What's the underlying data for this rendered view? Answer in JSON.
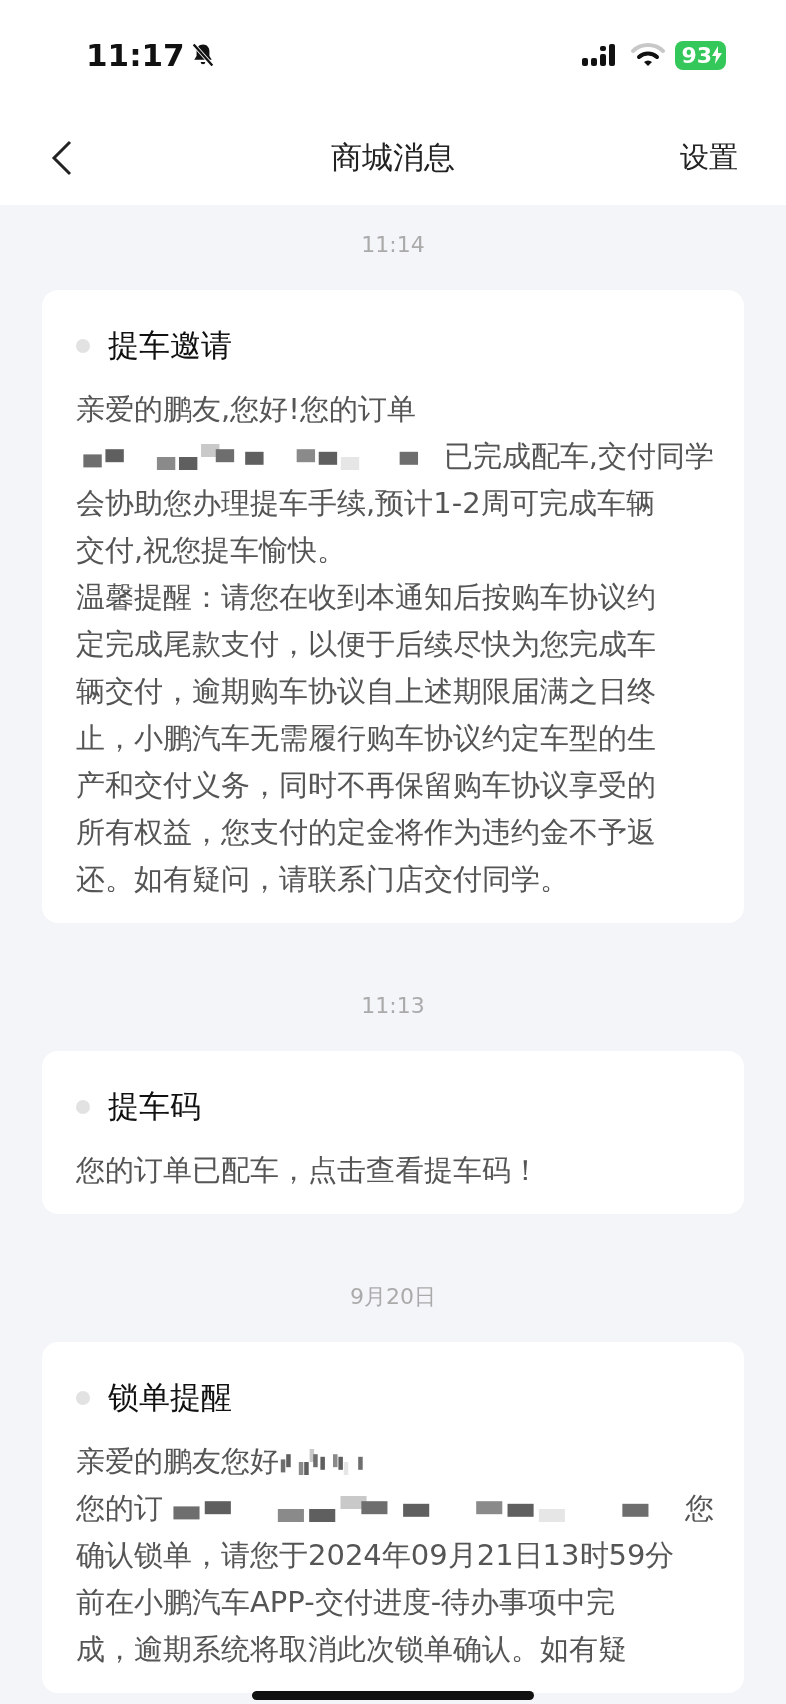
{
  "status_bar": {
    "time": "11:17",
    "battery": "93"
  },
  "nav": {
    "title": "商城消息",
    "action": "设置"
  },
  "groups": [
    {
      "time": "11:14",
      "message": {
        "title": "提车邀请",
        "lines": [
          [
            {
              "kind": "text",
              "text": "亲爱的鹏友,您好!您的订单"
            }
          ],
          [
            {
              "kind": "redacted"
            },
            {
              "kind": "text",
              "text": "已完成配车,交付同学"
            }
          ],
          [
            {
              "kind": "text",
              "text": "会协助您办理提车手续,预计1-2周可完成车辆"
            }
          ],
          [
            {
              "kind": "text",
              "text": "交付,祝您提车愉快。"
            }
          ],
          [
            {
              "kind": "text",
              "text": "温馨提醒：请您在收到本通知后按购车协议约"
            }
          ],
          [
            {
              "kind": "text",
              "text": "定完成尾款支付，以便于后续尽快为您完成车"
            }
          ],
          [
            {
              "kind": "text",
              "text": "辆交付，逾期购车协议自上述期限届满之日终"
            }
          ],
          [
            {
              "kind": "text",
              "text": "止，小鹏汽车无需履行购车协议约定车型的生"
            }
          ],
          [
            {
              "kind": "text",
              "text": "产和交付义务，同时不再保留购车协议享受的"
            }
          ],
          [
            {
              "kind": "text",
              "text": "所有权益，您支付的定金将作为违约金不予返"
            }
          ],
          [
            {
              "kind": "text",
              "text": "还。如有疑问，请联系门店交付同学。"
            }
          ]
        ]
      }
    },
    {
      "time": "11:13",
      "message": {
        "title": "提车码",
        "lines": [
          [
            {
              "kind": "text",
              "text": "您的订单已配车，点击查看提车码！"
            }
          ]
        ]
      }
    },
    {
      "time": "9月20日",
      "message": {
        "title": "锁单提醒",
        "lines": [
          [
            {
              "kind": "text",
              "text": "亲爱的鹏友"
            },
            {
              "kind": "text",
              "text": "您好"
            },
            {
              "kind": "redacted"
            }
          ],
          [
            {
              "kind": "text",
              "text": "您的订"
            },
            {
              "kind": "redacted"
            },
            {
              "kind": "text",
              "text": "您"
            }
          ],
          [
            {
              "kind": "text",
              "text": "确认锁单，请您于2024年09月21日13时59分"
            }
          ],
          [
            {
              "kind": "text",
              "text": "前在小鹏汽车APP-交付进度-待办事项中完"
            }
          ],
          [
            {
              "kind": "text",
              "text": "成，逾期系统将取消此次锁单确认。如有疑"
            }
          ]
        ]
      }
    }
  ]
}
